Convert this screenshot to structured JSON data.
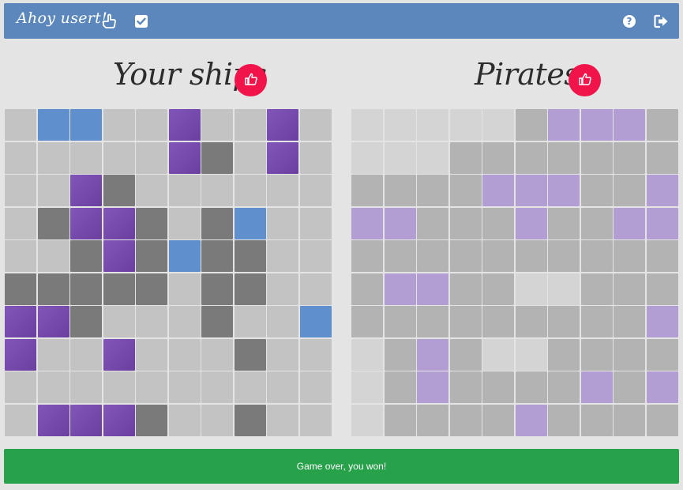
{
  "header": {
    "greeting": "Ahoy usert!",
    "icons": [
      "hand-pointing-icon",
      "checkbox-checked-icon",
      "help-icon",
      "logout-icon"
    ]
  },
  "boards": [
    {
      "title": "Your ships",
      "rows": [
        "EWWEEHEEHE",
        "EEEEEHSEHE",
        "EEHSEEEEEE",
        "ESHHSESWEE",
        "EESHSWSSEE",
        "SSSSSESSEE",
        "HHSEEESEEW",
        "HEEHEEESEE",
        "EEEEEEEEEE",
        "EHHHSEESEE"
      ]
    },
    {
      "title": "Pirates",
      "rows": [
        "UUUUUMXXXM",
        "UUUMMMMMMM",
        "MMMMXXXMMX",
        "XXMMMXMMXX",
        "MMMMMMMMMM",
        "MXXMMUUMMM",
        "MMMMMMMMMX",
        "UMXMUUMMMM",
        "UMXMMMMXMX",
        "UMMMMXMMMM"
      ]
    }
  ],
  "cell_legend": {
    "E": "empty-water",
    "S": "own-ship-grey",
    "H": "hit-ship",
    "W": "miss-blue",
    "U": "unexplored",
    "M": "missed-shot",
    "X": "hit"
  },
  "colors": {
    "topbar": "#5b87bd",
    "thumb_button": "#f0144a",
    "status_bar": "#27a24a",
    "hit": "#7449ac",
    "enemy_hit": "#b29ed3"
  },
  "status": {
    "message": "Game over, you won!"
  }
}
